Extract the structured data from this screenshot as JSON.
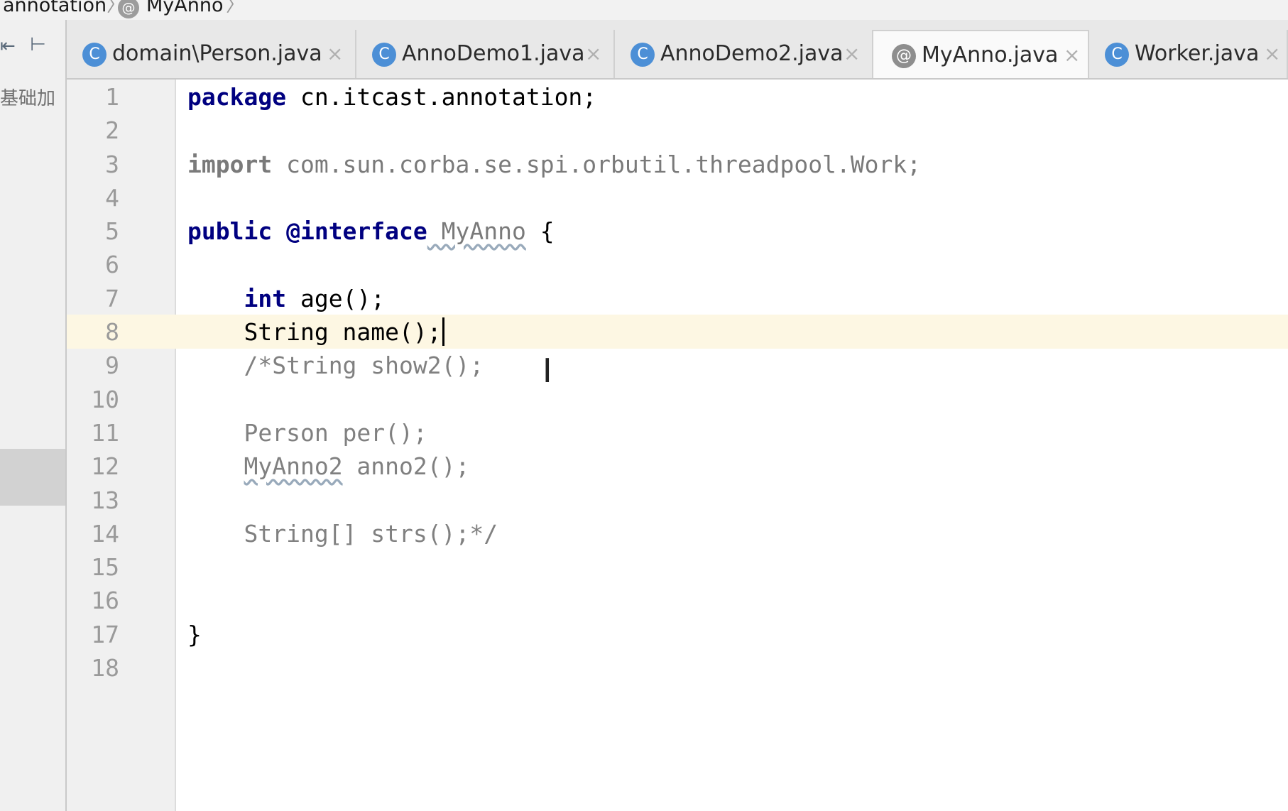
{
  "breadcrumb": {
    "package_item": "annotation",
    "separator": "〉",
    "file_badge": "@",
    "file_item": "MyAnno"
  },
  "left_panel": {
    "project_label": "基础加",
    "icons": [
      "collapse-icon",
      "pin-left-icon"
    ]
  },
  "tabs": [
    {
      "icon": "C",
      "label": "domain\\Person.java",
      "close": "×",
      "active": false
    },
    {
      "icon": "C",
      "label": "AnnoDemo1.java",
      "close": "×",
      "active": false
    },
    {
      "icon": "C",
      "label": "AnnoDemo2.java",
      "close": "×",
      "active": false
    },
    {
      "icon": "@",
      "label": "MyAnno.java",
      "close": "×",
      "active": true
    },
    {
      "icon": "C",
      "label": "Worker.java",
      "close": "×",
      "active": false
    }
  ],
  "editor": {
    "current_line": 8,
    "lines": [
      {
        "n": "1",
        "kw": "package",
        "rest": " cn.itcast.annotation;"
      },
      {
        "n": "2"
      },
      {
        "n": "3",
        "kw": "import",
        "rest": " com.sun.corba.se.spi.orbutil.threadpool.Work;"
      },
      {
        "n": "4"
      },
      {
        "n": "5",
        "kw": "public",
        "kw2": " @interface",
        "name": " MyAnno",
        "rest": " {"
      },
      {
        "n": "6"
      },
      {
        "n": "7",
        "kw": "int",
        "rest": " age();"
      },
      {
        "n": "8",
        "rest": "String name();"
      },
      {
        "n": "9",
        "comment": "/*String show2();"
      },
      {
        "n": "10"
      },
      {
        "n": "11",
        "comment": "Person per();"
      },
      {
        "n": "12",
        "comment_a": "MyAnno2",
        "comment_b": " anno2();"
      },
      {
        "n": "13"
      },
      {
        "n": "14",
        "comment": "String[] strs();*/"
      },
      {
        "n": "15"
      },
      {
        "n": "16"
      },
      {
        "n": "17",
        "rest": "}"
      },
      {
        "n": "18"
      }
    ]
  },
  "colors": {
    "keyword": "#000080",
    "comment": "#808080",
    "current_line_bg": "#fdf7e3",
    "class_icon": "#4c8fd6"
  }
}
